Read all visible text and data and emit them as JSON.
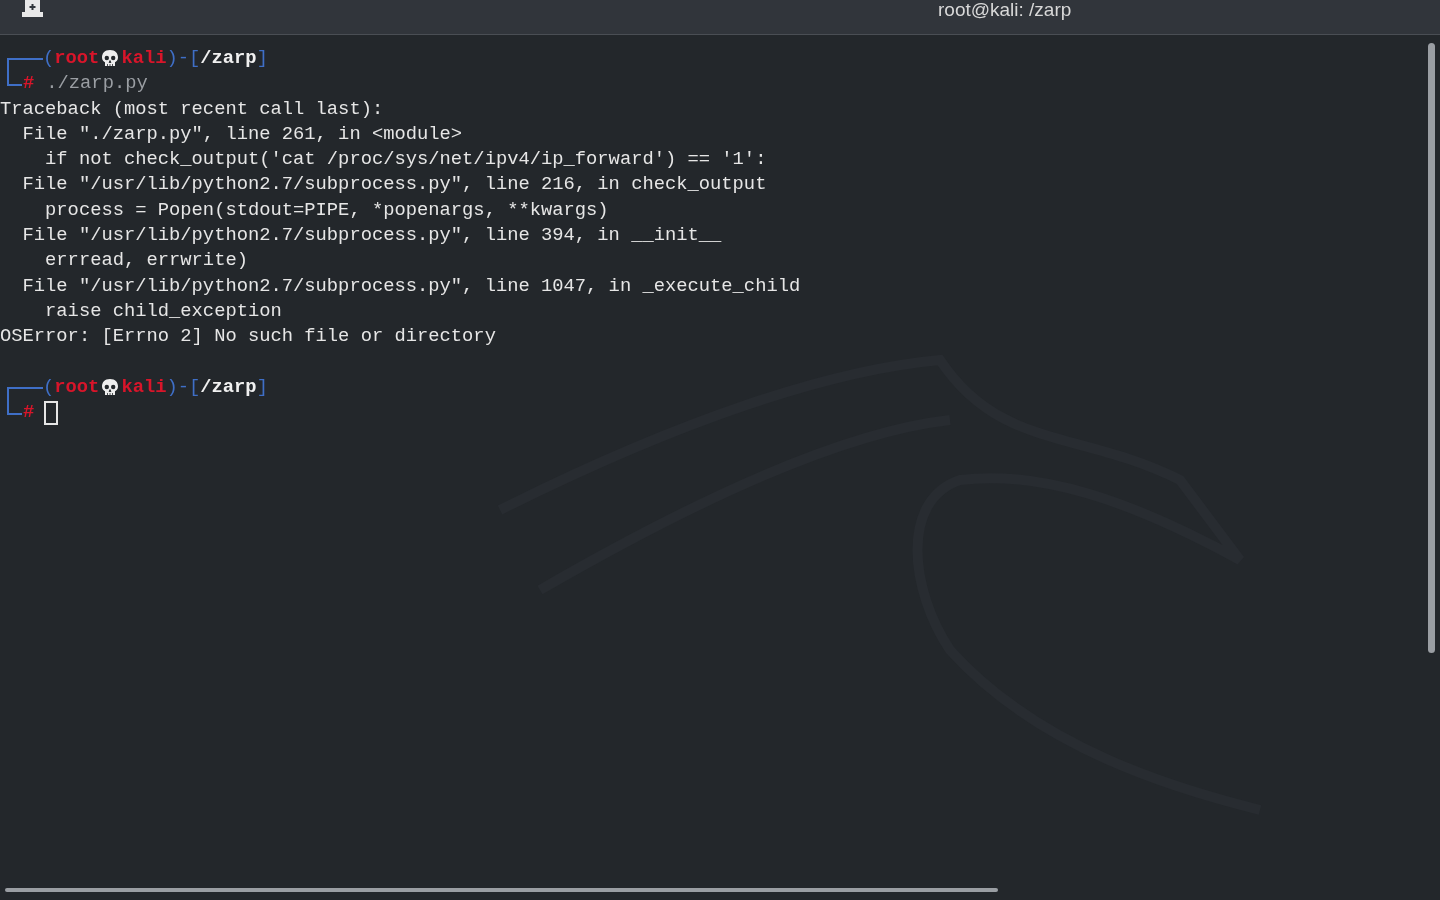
{
  "window": {
    "title": "root@kali: /zarp"
  },
  "blocks": [
    {
      "kind": "prompt",
      "open": "(",
      "user": "root",
      "host": "kali",
      "mid": ")-[",
      "path": "/zarp",
      "close": "]",
      "symbol": "#",
      "command": "./zarp.py",
      "cursor": false
    },
    {
      "kind": "output",
      "lines": [
        "Traceback (most recent call last):",
        "  File \"./zarp.py\", line 261, in <module>",
        "    if not check_output('cat /proc/sys/net/ipv4/ip_forward') == '1':",
        "  File \"/usr/lib/python2.7/subprocess.py\", line 216, in check_output",
        "    process = Popen(stdout=PIPE, *popenargs, **kwargs)",
        "  File \"/usr/lib/python2.7/subprocess.py\", line 394, in __init__",
        "    errread, errwrite)",
        "  File \"/usr/lib/python2.7/subprocess.py\", line 1047, in _execute_child",
        "    raise child_exception",
        "OSError: [Errno 2] No such file or directory"
      ]
    },
    {
      "kind": "blank"
    },
    {
      "kind": "prompt",
      "open": "(",
      "user": "root",
      "host": "kali",
      "mid": ")-[",
      "path": "/zarp",
      "close": "]",
      "symbol": "#",
      "cursor": true
    }
  ]
}
